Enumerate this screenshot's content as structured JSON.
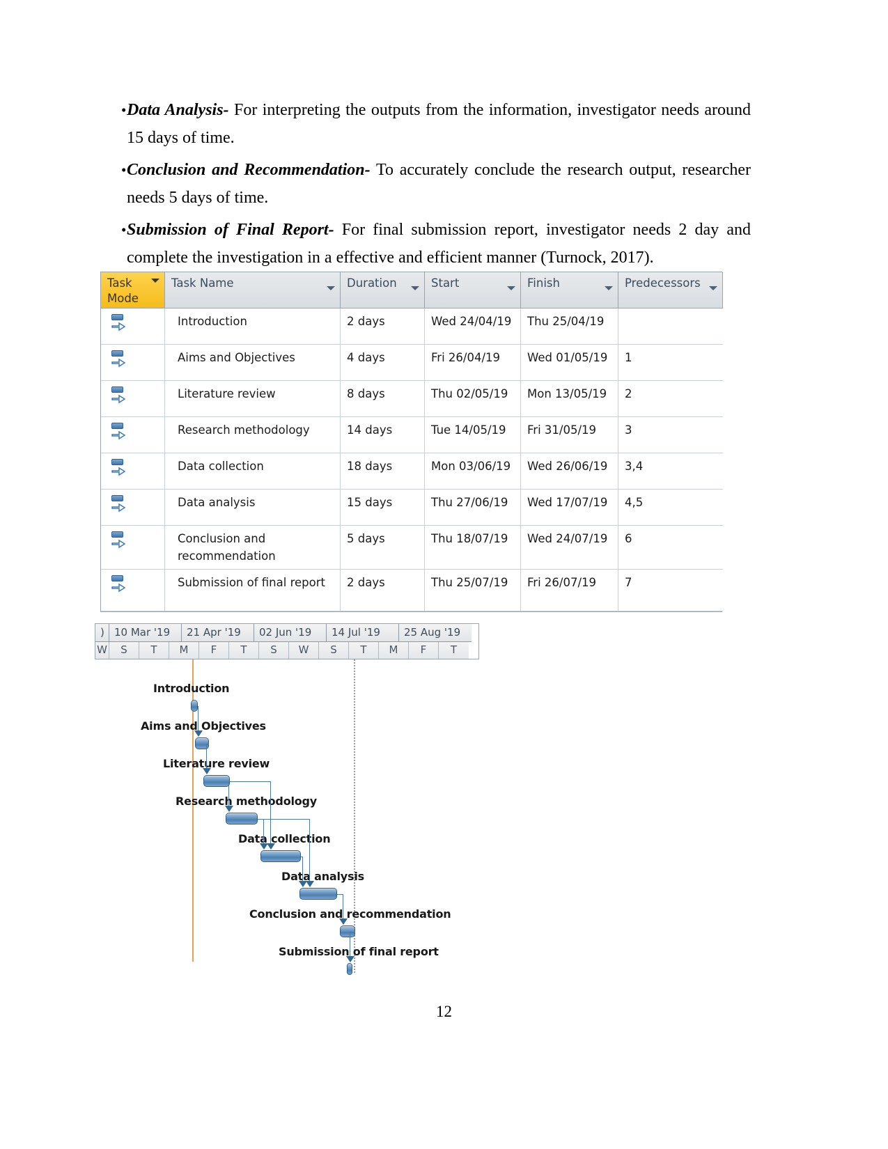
{
  "document": {
    "page_number": "12",
    "bullets": [
      {
        "marker": "•",
        "lead": "Data Analysis-",
        "body": " For interpreting the outputs from the information, investigator needs around 15 days of time."
      },
      {
        "marker": "•",
        "lead": "Conclusion and Recommendation-",
        "body": " To accurately conclude the research output, researcher needs 5 days of time."
      },
      {
        "marker": "•",
        "lead": "Submission of Final Report-",
        "body": " For final submission report, investigator needs 2 day and complete the investigation in a effective and efficient manner (Turnock, 2017)."
      }
    ]
  },
  "project_table": {
    "accent_header_color": "#f5bc1b",
    "header_color": "#dfe3e7",
    "columns": [
      {
        "label": "Task\nMode",
        "key": "task_mode",
        "filter_icon": "chevron-down-icon"
      },
      {
        "label": "Task Name",
        "key": "task_name",
        "filter_icon": "chevron-down-icon"
      },
      {
        "label": "Duration",
        "key": "duration",
        "filter_icon": "chevron-down-icon"
      },
      {
        "label": "Start",
        "key": "start",
        "filter_icon": "chevron-down-icon"
      },
      {
        "label": "Finish",
        "key": "finish",
        "filter_icon": "chevron-down-icon"
      },
      {
        "label": "Predecessors",
        "key": "predecessors",
        "filter_icon": "chevron-down-icon"
      }
    ],
    "rows": [
      {
        "id": 1,
        "mode_icon": "auto-schedule-icon",
        "task_name": "Introduction",
        "duration": "2 days",
        "start": "Wed 24/04/19",
        "finish": "Thu 25/04/19",
        "predecessors": ""
      },
      {
        "id": 2,
        "mode_icon": "auto-schedule-icon",
        "task_name": "Aims and Objectives",
        "duration": "4 days",
        "start": "Fri 26/04/19",
        "finish": "Wed 01/05/19",
        "predecessors": "1"
      },
      {
        "id": 3,
        "mode_icon": "auto-schedule-icon",
        "task_name": "Literature review",
        "duration": "8 days",
        "start": "Thu 02/05/19",
        "finish": "Mon 13/05/19",
        "predecessors": "2"
      },
      {
        "id": 4,
        "mode_icon": "auto-schedule-icon",
        "task_name": "Research methodology",
        "duration": "14 days",
        "start": "Tue 14/05/19",
        "finish": "Fri 31/05/19",
        "predecessors": "3"
      },
      {
        "id": 5,
        "mode_icon": "auto-schedule-icon",
        "task_name": "Data collection",
        "duration": "18 days",
        "start": "Mon 03/06/19",
        "finish": "Wed 26/06/19",
        "predecessors": "3,4"
      },
      {
        "id": 6,
        "mode_icon": "auto-schedule-icon",
        "task_name": "Data analysis",
        "duration": "15 days",
        "start": "Thu 27/06/19",
        "finish": "Wed 17/07/19",
        "predecessors": "4,5"
      },
      {
        "id": 7,
        "mode_icon": "auto-schedule-icon",
        "task_name": "Conclusion and recommendation",
        "duration": "5 days",
        "start": "Thu 18/07/19",
        "finish": "Wed 24/07/19",
        "predecessors": "6"
      },
      {
        "id": 8,
        "mode_icon": "auto-schedule-icon",
        "task_name": "Submission of final report",
        "duration": "2 days",
        "start": "Thu 25/07/19",
        "finish": "Fri 26/07/19",
        "predecessors": "7"
      }
    ]
  },
  "chart_data": {
    "type": "bar",
    "title": "Gantt chart timeline",
    "xlabel": "",
    "ylabel": "",
    "timescale": {
      "top_tier_partial_left": ")",
      "top_tier": [
        "10 Mar '19",
        "21 Apr '19",
        "02 Jun '19",
        "14 Jul '19",
        "25 Aug '19"
      ],
      "bottom_tier_partial_left": "W",
      "bottom_tier": [
        "S",
        "T",
        "M",
        "F",
        "T",
        "S",
        "W",
        "S",
        "T",
        "M",
        "F",
        "T"
      ]
    },
    "markers": {
      "today_line_color": "#e8a055",
      "status_line_style": "dotted",
      "status_line_color": "#9a9a9a"
    },
    "categories": [
      "Introduction",
      "Aims and Objectives",
      "Literature review",
      "Research methodology",
      "Data collection",
      "Data analysis",
      "Conclusion and recommendation",
      "Submission of final report"
    ],
    "values": [
      2,
      4,
      8,
      14,
      18,
      15,
      5,
      2
    ],
    "bars": [
      {
        "label": "Introduction",
        "duration_days": 2,
        "start": "Wed 24/04/19",
        "finish": "Thu 25/04/19",
        "predecessors": ""
      },
      {
        "label": "Aims and Objectives",
        "duration_days": 4,
        "start": "Fri 26/04/19",
        "finish": "Wed 01/05/19",
        "predecessors": "1"
      },
      {
        "label": "Literature review",
        "duration_days": 8,
        "start": "Thu 02/05/19",
        "finish": "Mon 13/05/19",
        "predecessors": "2"
      },
      {
        "label": "Research methodology",
        "duration_days": 14,
        "start": "Tue 14/05/19",
        "finish": "Fri 31/05/19",
        "predecessors": "3"
      },
      {
        "label": "Data collection",
        "duration_days": 18,
        "start": "Mon 03/06/19",
        "finish": "Wed 26/06/19",
        "predecessors": "3,4"
      },
      {
        "label": "Data analysis",
        "duration_days": 15,
        "start": "Thu 27/06/19",
        "finish": "Wed 17/07/19",
        "predecessors": "4,5"
      },
      {
        "label": "Conclusion and recommendation",
        "duration_days": 5,
        "start": "Thu 18/07/19",
        "finish": "Wed 24/07/19",
        "predecessors": "6"
      },
      {
        "label": "Submission of final report",
        "duration_days": 2,
        "start": "Thu 25/07/19",
        "finish": "Fri 26/07/19",
        "predecessors": "7"
      }
    ],
    "bar_color": "#4a7fb0",
    "grid": false,
    "legend": "none"
  }
}
